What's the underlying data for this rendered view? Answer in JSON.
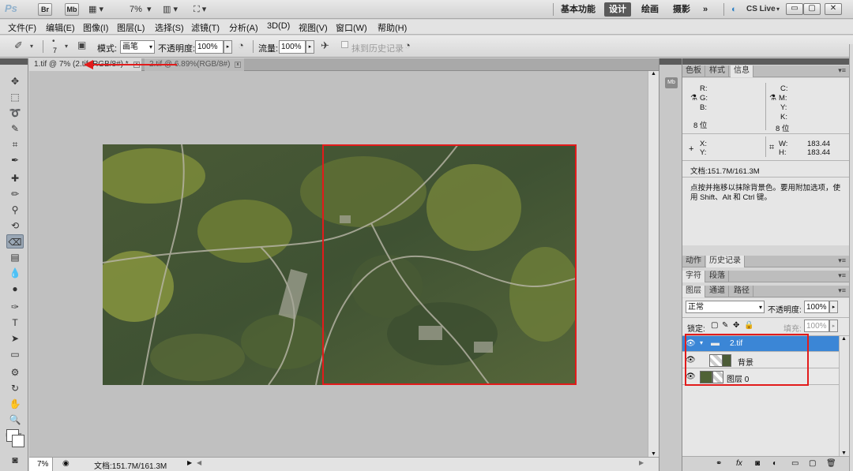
{
  "app": {
    "logo": "Ps",
    "bridge": "Br",
    "minibridge": "Mb",
    "zoom": "7%",
    "workspaces": [
      "基本功能",
      "设计",
      "绘画",
      "摄影"
    ],
    "more": "»",
    "cslive": "CS Live",
    "window_buttons": [
      "▭",
      "▢",
      "✕"
    ]
  },
  "menu": [
    "文件(F)",
    "编辑(E)",
    "图像(I)",
    "图层(L)",
    "选择(S)",
    "滤镜(T)",
    "分析(A)",
    "3D(D)",
    "视图(V)",
    "窗口(W)",
    "帮助(H)"
  ],
  "options": {
    "brush_size": "7",
    "mode_label": "模式:",
    "mode_value": "画笔",
    "opacity_label": "不透明度:",
    "opacity_value": "100%",
    "flow_label": "流量:",
    "flow_value": "100%",
    "erase_history": "抹到历史记录"
  },
  "tabs": [
    {
      "label": "1.tif @ 7% (2.tif, RGB/8#) *",
      "active": true
    },
    {
      "label": "2.tif @ 6.89%(RGB/8#)",
      "active": false
    }
  ],
  "status": {
    "zoom": "7%",
    "doc": "文档:151.7M/161.3M"
  },
  "info_panel": {
    "tabs": [
      "色板",
      "样式",
      "信息"
    ],
    "r": "R:",
    "g": "G:",
    "b": "B:",
    "bits1": "8 位",
    "c": "C:",
    "m": "M:",
    "y": "Y:",
    "k": "K:",
    "bits2": "8 位",
    "x": "X:",
    "yy": "Y:",
    "w": "W:",
    "w_val": "183.44",
    "h": "H:",
    "h_val": "183.44",
    "doc": "文档:151.7M/161.3M",
    "hint": "点按并拖移以抹除背景色。要用附加选项，使用 Shift、Alt 和 Ctrl 键。"
  },
  "history_panel": {
    "tabs": [
      "动作",
      "历史记录"
    ]
  },
  "char_panel": {
    "tabs": [
      "字符",
      "段落"
    ]
  },
  "layers_panel": {
    "tabs": [
      "图层",
      "通道",
      "路径"
    ],
    "blend": "正常",
    "opacity_label": "不透明度:",
    "opacity_value": "100%",
    "lock_label": "锁定:",
    "fill_label": "填充:",
    "fill_value": "100%",
    "layers": [
      {
        "name": "2.tif",
        "type": "group"
      },
      {
        "name": "背景",
        "type": "layer"
      },
      {
        "name": "图层 0",
        "type": "layer"
      }
    ]
  },
  "colors": {
    "selection": "#3b86d6",
    "annotation": "#e21b1b"
  }
}
